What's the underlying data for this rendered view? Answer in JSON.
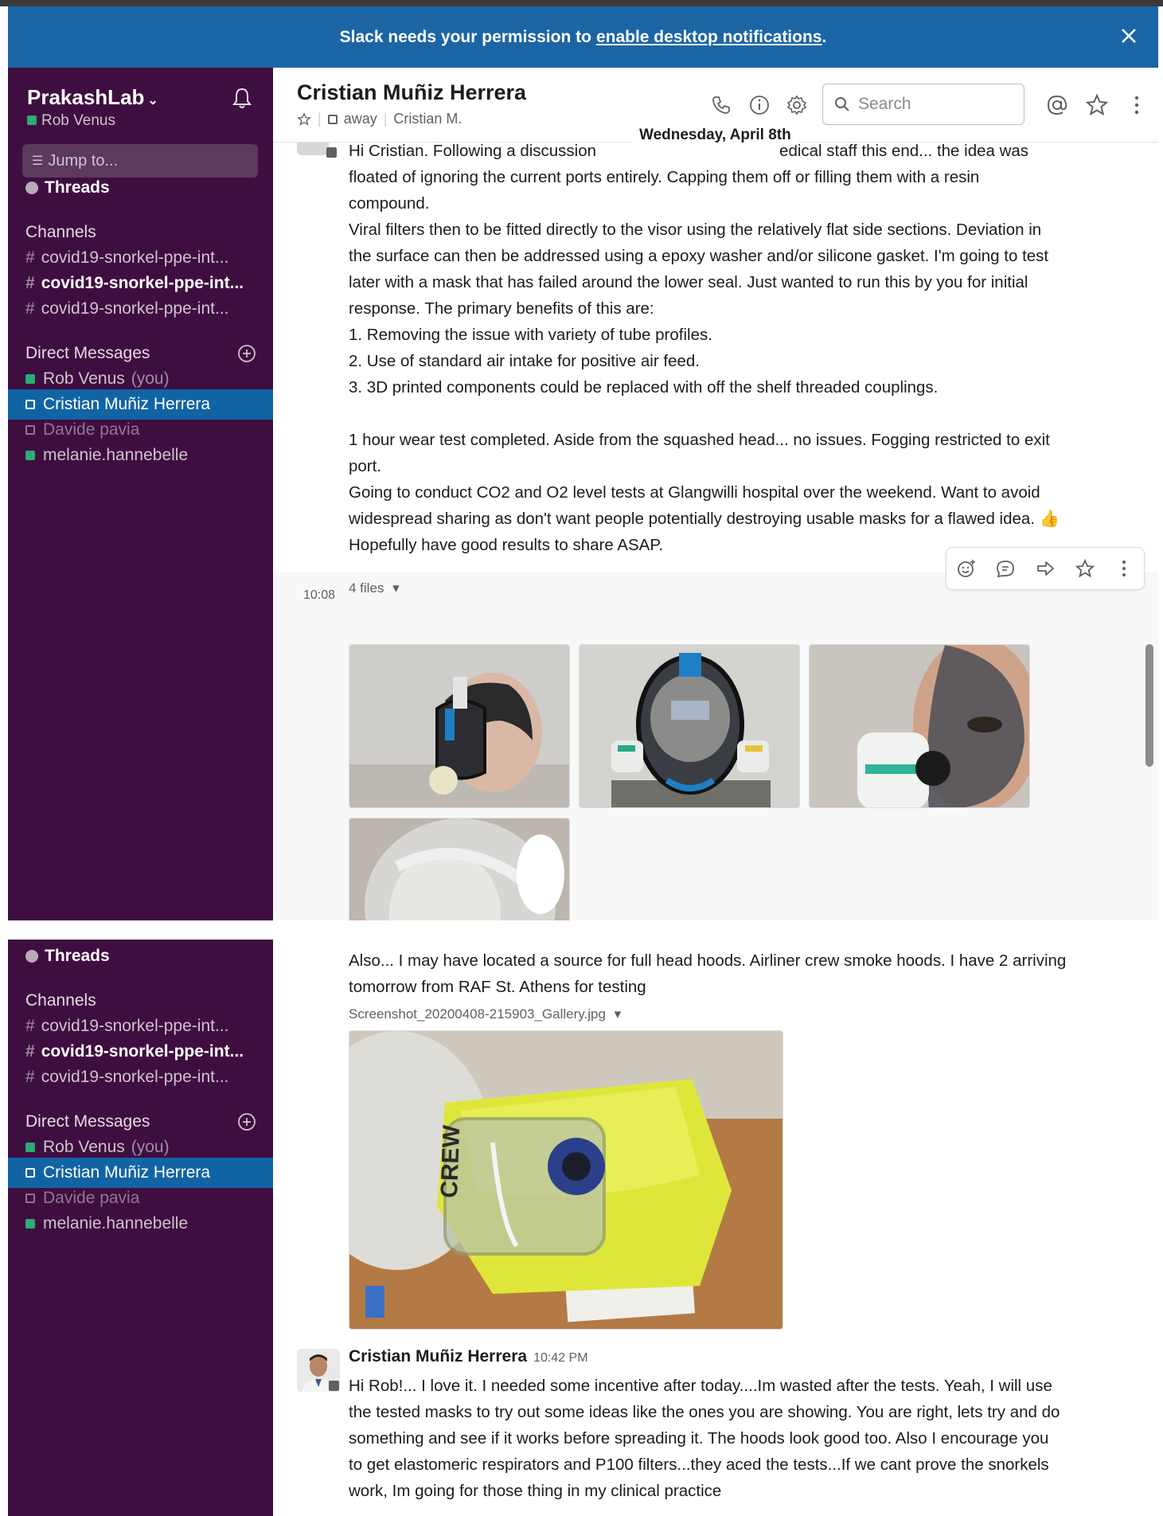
{
  "banner": {
    "prefix": "Slack needs your permission to",
    "link": "enable desktop notifications",
    "suffix": "."
  },
  "workspace": {
    "name": "PrakashLab",
    "chevron": "⌄",
    "user": "Rob Venus",
    "jump_placeholder": "Jump to..."
  },
  "sidebar": {
    "threads": "Threads",
    "channels_header": "Channels",
    "channels": [
      {
        "name": "covid19-snorkel-ppe-int...",
        "bold": false
      },
      {
        "name": "covid19-snorkel-ppe-int...",
        "bold": true
      },
      {
        "name": "covid19-snorkel-ppe-int...",
        "bold": false
      }
    ],
    "dm_header": "Direct Messages",
    "dms": [
      {
        "name": "Rob Venus",
        "suffix": "(you)",
        "status": "green"
      },
      {
        "name": "Cristian Muñiz Herrera",
        "status": "hollow",
        "active": true
      },
      {
        "name": "Davide pavia",
        "status": "hollow-dim"
      },
      {
        "name": "melanie.hannebelle",
        "status": "green"
      }
    ]
  },
  "channel_header": {
    "title": "Cristian Muñiz Herrera",
    "status": "away",
    "display_name": "Cristian M.",
    "search_placeholder": "Search"
  },
  "date_divider": "Wednesday, April 8th",
  "messages": {
    "block1": [
      "Hi Cristian. Following a discussion",
      "edical staff this end... the idea was",
      "floated of ignoring the current ports entirely. Capping them off or filling them with a resin",
      "compound.",
      "Viral filters then to be fitted directly to the visor using the relatively flat side sections. Deviation in",
      "the surface can then be addressed using a epoxy washer and/or silicone gasket. I'm going to test",
      "later with a mask that has failed around the lower seal. Just wanted to run this by you for initial",
      "response. The primary benefits of this are:",
      "1. Removing the issue with variety of tube profiles.",
      "2. Use of standard air intake for positive air feed.",
      "3. 3D printed components could be replaced with off the shelf threaded couplings."
    ],
    "block2": [
      "1 hour wear test completed. Aside from the squashed head... no issues. Fogging restricted to exit",
      "port.",
      "Going to conduct CO2 and O2 level tests at Glangwilli hospital over the weekend. Want to avoid",
      "widespread sharing as don't want people potentially destroying usable masks for a flawed idea. 👍",
      "Hopefully have good results to share ASAP."
    ],
    "time": "10:08",
    "files_label": "4 files",
    "files_chevron": "▾",
    "block3": [
      "Also... I may have located a source for full head hoods. Airliner crew smoke hoods. I have 2 arriving",
      "tomorrow from RAF St. Athens for testing"
    ],
    "attachment_name": "Screenshot_20200408-215903_Gallery.jpg",
    "attachment_image_text": "CREW",
    "reply_author": "Cristian Muñiz Herrera",
    "reply_time": "10:42 PM",
    "reply_lines": [
      "Hi Rob!... I love it.  I needed some incentive after today....Im wasted after the tests.   Yeah, I will use",
      "the tested masks to try out some ideas like the ones you are showing.  You are right, lets try and do",
      "something and see if it works before spreading it.   The hoods look good too.   Also I encourage you",
      "to get elastomeric respirators and P100 filters...they aced the tests...If we cant prove the snorkels",
      "work, Im going for those thing in my clinical practice"
    ]
  },
  "colors": {
    "sidebar": "#3f0e40",
    "banner": "#1c65a5",
    "active": "#1164a3",
    "presence": "#2bac76"
  }
}
